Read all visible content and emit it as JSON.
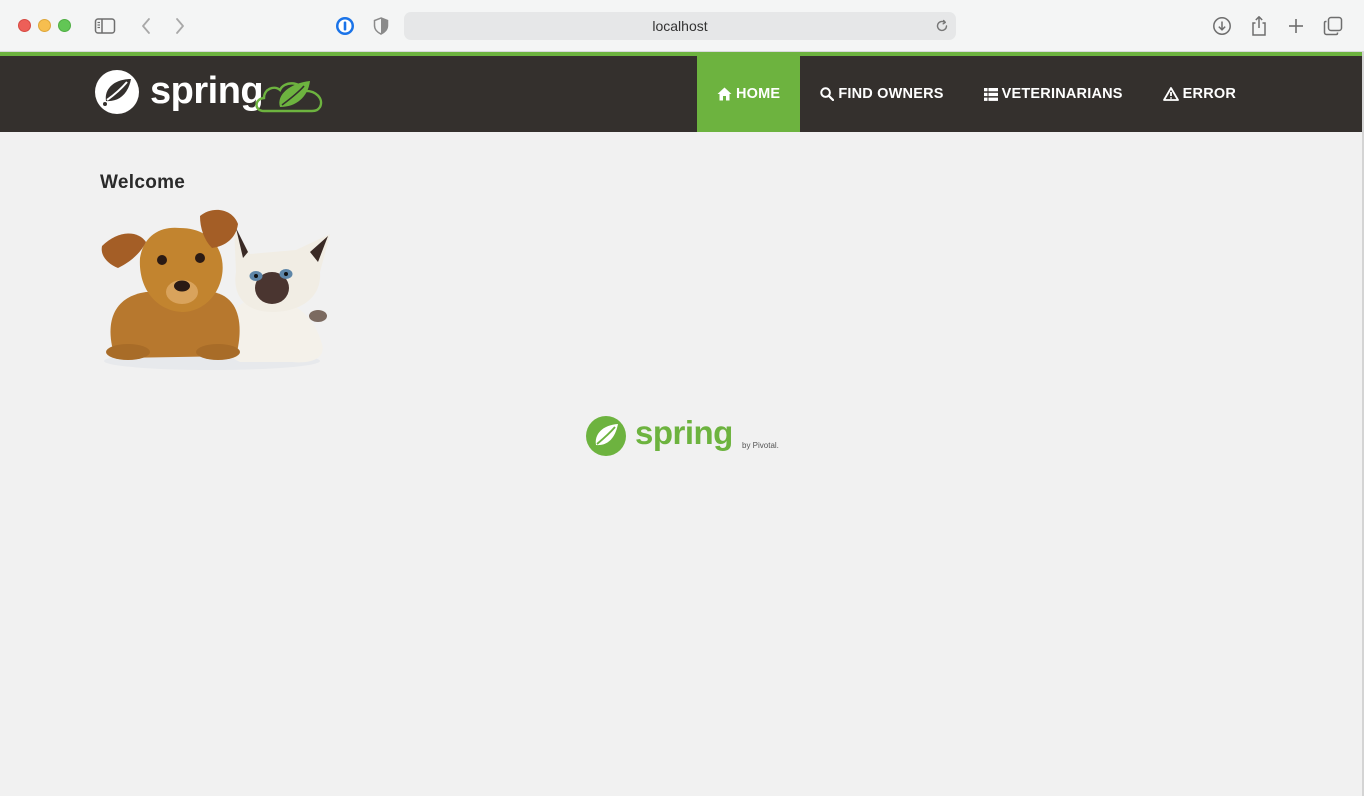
{
  "browser": {
    "address": "localhost"
  },
  "navbar": {
    "items": [
      {
        "label": "HOME",
        "icon": "home-icon",
        "active": true
      },
      {
        "label": "FIND OWNERS",
        "icon": "search-icon",
        "active": false
      },
      {
        "label": "VETERINARIANS",
        "icon": "list-icon",
        "active": false
      },
      {
        "label": "ERROR",
        "icon": "warning-icon",
        "active": false
      }
    ]
  },
  "main": {
    "heading": "Welcome"
  },
  "footer": {
    "logo_text": "spring",
    "logo_byline": "by Pivotal."
  },
  "brand": {
    "logo_text": "spring",
    "accent": "#6db33f",
    "navbar_bg": "#34302d",
    "page_bg": "#f1f1f1"
  }
}
